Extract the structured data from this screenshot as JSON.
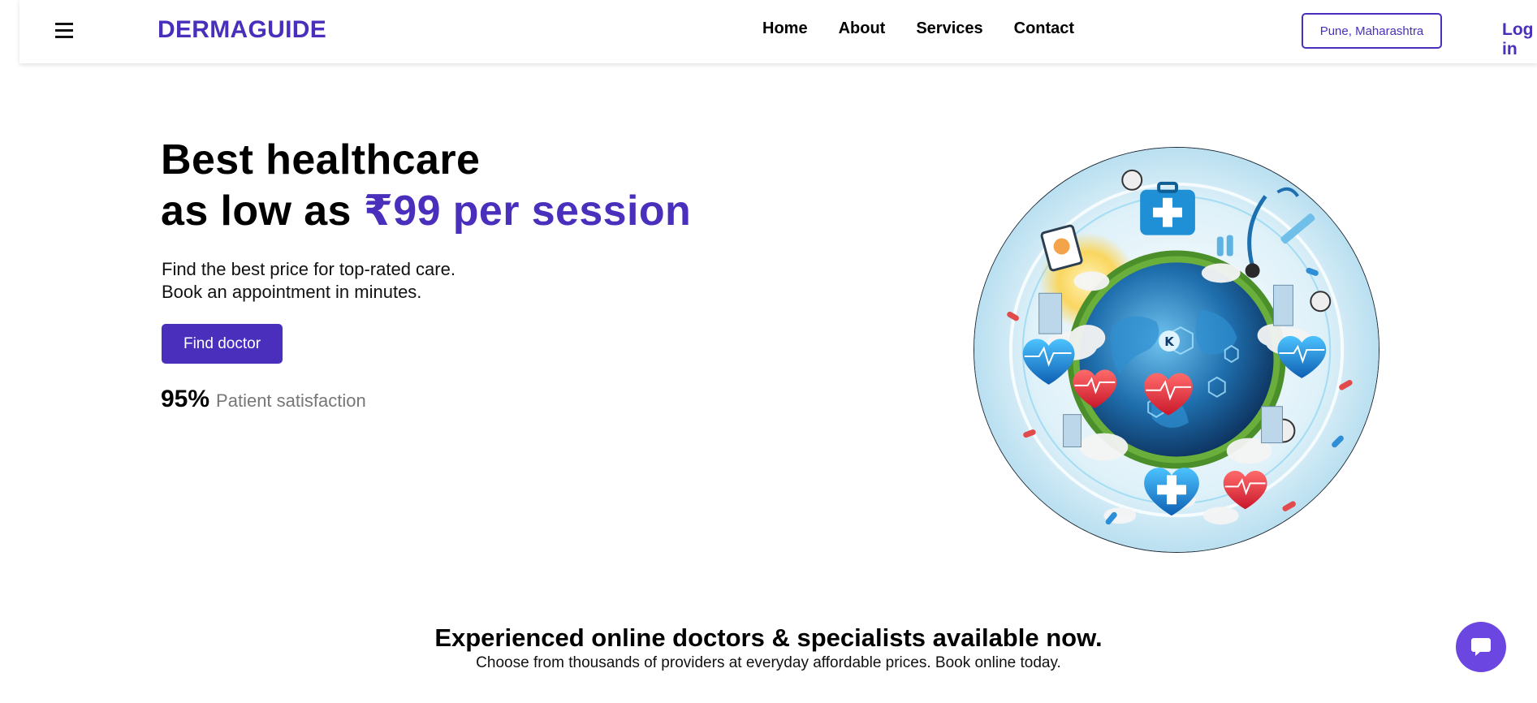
{
  "header": {
    "brand": "DERMAGUIDE",
    "menu_icon": "hamburger-menu-icon",
    "nav": [
      {
        "label": "Home"
      },
      {
        "label": "About"
      },
      {
        "label": "Services"
      },
      {
        "label": "Contact"
      }
    ],
    "location": "Pune, Maharashtra",
    "login": "Log in"
  },
  "hero": {
    "title_line1": "Best healthcare",
    "title_line2_prefix": "as low as ",
    "title_line2_accent": "₹99 per session",
    "subtitle_line1": "Find the best price for top-rated care.",
    "subtitle_line2": "Book an appointment in minutes.",
    "cta": "Find doctor",
    "stat_value": "95%",
    "stat_label": "Patient satisfaction",
    "illustration_icon": "healthcare-globe-illustration"
  },
  "section": {
    "title": "Experienced online doctors & specialists available now.",
    "subtitle": "Choose from thousands of providers at everyday affordable prices. Book online today."
  },
  "chat": {
    "icon": "chat-bubble-icon"
  },
  "colors": {
    "brand": "#4a2fbd",
    "chat_fab": "#6b46e0"
  }
}
